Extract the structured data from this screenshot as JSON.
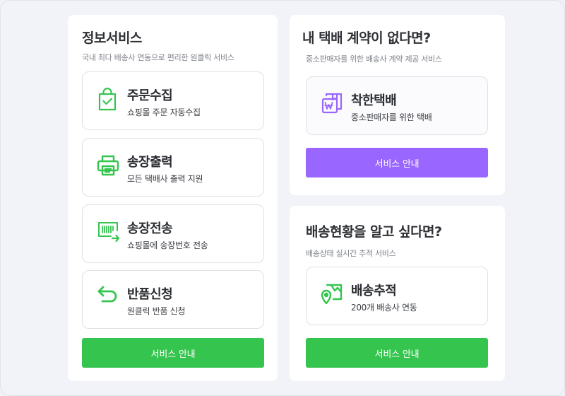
{
  "colors": {
    "green": "#35c54f",
    "purple": "#9966ff"
  },
  "info": {
    "title": "정보서비스",
    "subtitle": "국내 최다 배송사 연동으로 편리한 원클릭 서비스",
    "items": [
      {
        "icon": "shopping-bag-check-icon",
        "title": "주문수집",
        "desc": "쇼핑몰 주문 자동수집"
      },
      {
        "icon": "printer-icon",
        "title": "송장출력",
        "desc": "모든 택배사 출력 지원"
      },
      {
        "icon": "barcode-send-icon",
        "title": "송장전송",
        "desc": "쇼핑몰에 송장번호 전송"
      },
      {
        "icon": "return-arrow-icon",
        "title": "반품신청",
        "desc": "원클릭 반품 신청"
      }
    ],
    "button": "서비스 안내"
  },
  "contract": {
    "title": "내 택배 계약이 없다면?",
    "subtitle": "중소판매자를 위한 배송사 계약 제공 서비스",
    "item": {
      "icon": "won-box-icon",
      "title": "착한택배",
      "desc": "중소판매자를 위한 택배"
    },
    "button": "서비스 안내"
  },
  "tracking": {
    "title": "배송현황을 알고 싶다면?",
    "subtitle": "배송상태 실시간 추적 서비스",
    "item": {
      "icon": "map-pin-icon",
      "title": "배송추적",
      "desc": "200개 배송사 연동"
    },
    "button": "서비스 안내"
  }
}
